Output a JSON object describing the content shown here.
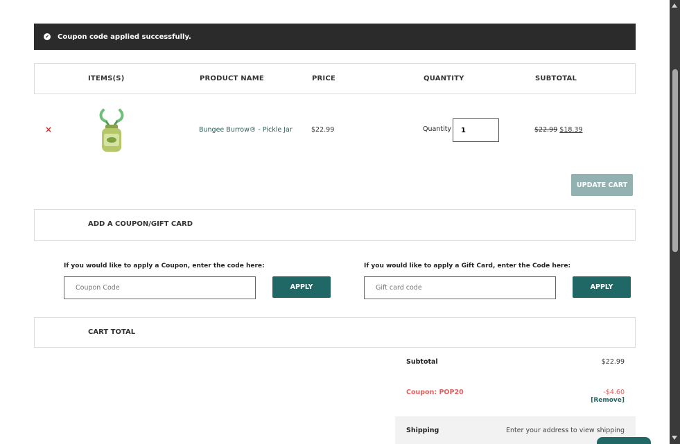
{
  "notice": {
    "message": "Coupon code applied successfully.",
    "icon": "check-circle-icon"
  },
  "cart_table": {
    "headers": [
      "ITEMS(S)",
      "PRODUCT NAME",
      "PRICE",
      "QUANTITY",
      "SUBTOTAL"
    ],
    "rows": [
      {
        "remove_glyph": "×",
        "product_name": "Bungee Burrow® - Pickle Jar",
        "price": "$22.99",
        "quantity_label": "Quantity",
        "quantity_value": "1",
        "subtotal_old": "$22.99",
        "subtotal_new": "$18.39"
      }
    ]
  },
  "update_cart_label": "UPDATE CART",
  "coupon_section": {
    "title": "ADD A COUPON/GIFT CARD",
    "coupon_prompt": "If you would like to apply a Coupon, enter the code here:",
    "coupon_placeholder": "Coupon Code",
    "coupon_apply": "APPLY",
    "gift_prompt": "If you would like to apply a Gift Card, enter the Code here:",
    "gift_placeholder": "Gift card code",
    "gift_apply": "APPLY"
  },
  "cart_total": {
    "title": "CART TOTAL",
    "subtotal_label": "Subtotal",
    "subtotal_value": "$22.99",
    "coupon_label": "Coupon: POP20",
    "coupon_value": "-$4.60",
    "remove_link": "[Remove]",
    "shipping_label": "Shipping",
    "shipping_value": "Enter your address to view shipping"
  },
  "colors": {
    "primary_button": "#1f6866",
    "disabled_button": "#93b1b1",
    "notice_bg": "#2b2b2b",
    "discount": "#e06060",
    "remove_x": "#d32f2f"
  }
}
